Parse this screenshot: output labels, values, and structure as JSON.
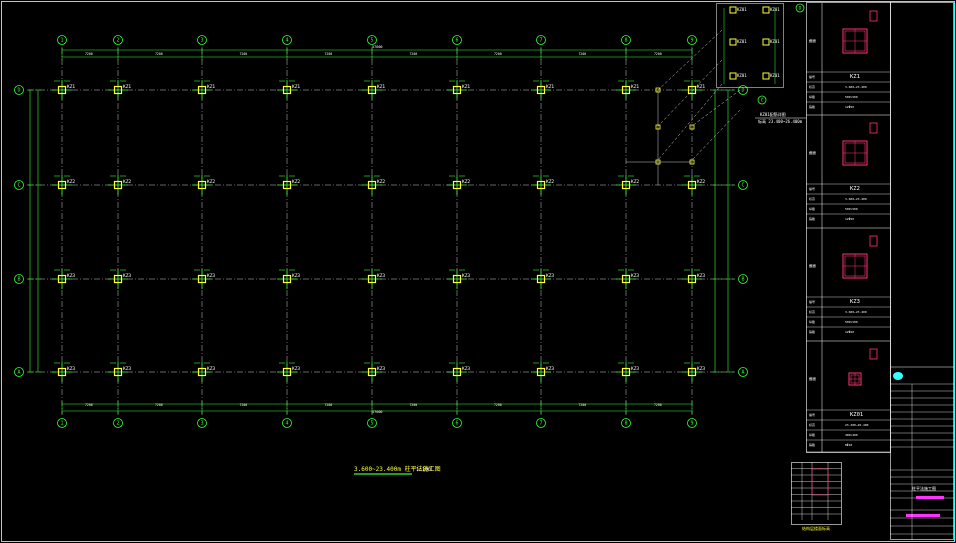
{
  "plan": {
    "col_labels": [
      "1",
      "2",
      "3",
      "4",
      "5",
      "6",
      "7",
      "8",
      "9"
    ],
    "row_labels": [
      "D",
      "C",
      "B",
      "A"
    ],
    "overall_dim": "57600",
    "bay_dims": [
      "7200",
      "7200",
      "7200",
      "7200",
      "7200",
      "7200",
      "7200",
      "7200"
    ],
    "caption": "3.600~23.400m 柱平法施工图",
    "caption_scale": "1:100",
    "column_tags": [
      "KZ1",
      "KZ2",
      "KZ3"
    ],
    "colors": {
      "axis": "#33ff33",
      "grid": "#ffffff",
      "column": "#ffff33",
      "bubble": "#33ff33"
    }
  },
  "detail": {
    "tag": "KZ01",
    "note_line1": "KZ01配筋详图",
    "note_line2": "标高 23.400~26.400m",
    "rows": [
      "D",
      "C"
    ]
  },
  "schedule": {
    "sections": [
      {
        "tag": "KZ1",
        "elev": "3.600~23.400",
        "size": "500×500",
        "rebar": "12Φ20"
      },
      {
        "tag": "KZ2",
        "elev": "3.600~23.400",
        "size": "500×500",
        "rebar": "12Φ20"
      },
      {
        "tag": "KZ3",
        "elev": "3.600~23.400",
        "size": "500×500",
        "rebar": "12Φ20"
      },
      {
        "tag": "KZ01",
        "elev": "23.400~26.400",
        "size": "400×400",
        "rebar": "8Φ18"
      }
    ],
    "row_labels": [
      "截面",
      "编号",
      "标高",
      "纵筋",
      "箍筋"
    ]
  },
  "title_block": {
    "drawing_title": "柱平法施工图",
    "note_table_title": "结构层楼面标高"
  }
}
